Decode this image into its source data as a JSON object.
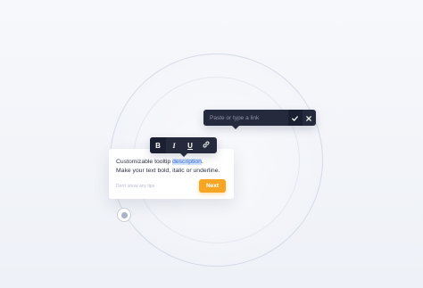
{
  "link_bar": {
    "placeholder": "Paste or type a link",
    "confirm_icon": "checkmark-icon",
    "close_icon": "close-icon"
  },
  "format_bar": {
    "buttons": [
      {
        "label": "B",
        "icon": "bold-icon",
        "active": true
      },
      {
        "label": "I",
        "icon": "italic-icon",
        "active": false
      },
      {
        "label": "U",
        "icon": "underline-icon",
        "active": false
      },
      {
        "label": "",
        "icon": "link-icon",
        "active": false
      }
    ]
  },
  "tooltip": {
    "line1_prefix": "Customizable tooltip ",
    "line1_highlight": "description",
    "line1_suffix": ".",
    "line2": "Make your text bold, italic or underline.",
    "dont_show": "Don't show any tips",
    "next_label": "Next"
  },
  "hotspot": {
    "icon": "hotspot-icon"
  },
  "colors": {
    "toolbar_bg": "#252b3d",
    "accent": "#f6a623",
    "highlight_bg": "#cfe3ff",
    "highlight_text": "#3c6fd4"
  }
}
